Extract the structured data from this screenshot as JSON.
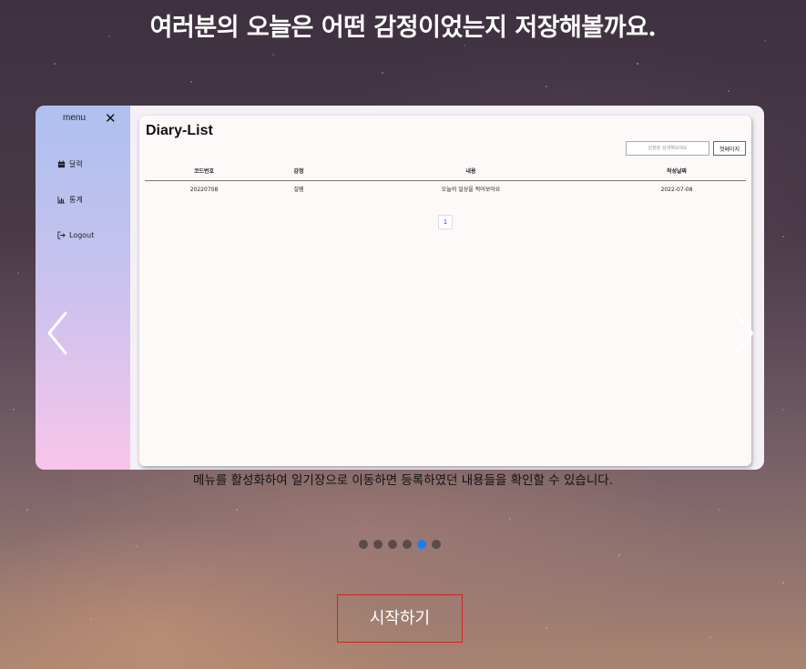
{
  "headline": "여러분의 오늘은 어떤 감정이었는지 저장해볼까요.",
  "carousel": {
    "prev_icon": "chevron-left-icon",
    "next_icon": "chevron-right-icon",
    "dots_count": 6,
    "active_dot_index": 4,
    "active_dot_color": "#1a7ef0"
  },
  "sidebar": {
    "menu_label": "menu",
    "close_label": "✕",
    "items": [
      {
        "label": "달력",
        "icon": "calendar-icon"
      },
      {
        "label": "통계",
        "icon": "bar-chart-icon"
      },
      {
        "label": "Logout",
        "icon": "logout-icon"
      }
    ]
  },
  "panel": {
    "title": "Diary-List",
    "search_placeholder": "감정을 검색해보세요",
    "search_button": "첫페이지",
    "columns": [
      "코드번호",
      "감정",
      "내용",
      "작성날짜"
    ],
    "rows": [
      [
        "20220708",
        "설렘",
        "오늘의 일상을 적어보아요",
        "2022-07-08"
      ]
    ],
    "page": "1"
  },
  "caption": "메뉴를 활성화하여 일기장으로 이동하면 등록하였던 내용들을 확인할 수 있습니다.",
  "start_button": "시작하기",
  "colors": {
    "start_border": "#d82020",
    "sidebar_top": "#aec0ef",
    "sidebar_bottom": "#f8c4ea"
  }
}
